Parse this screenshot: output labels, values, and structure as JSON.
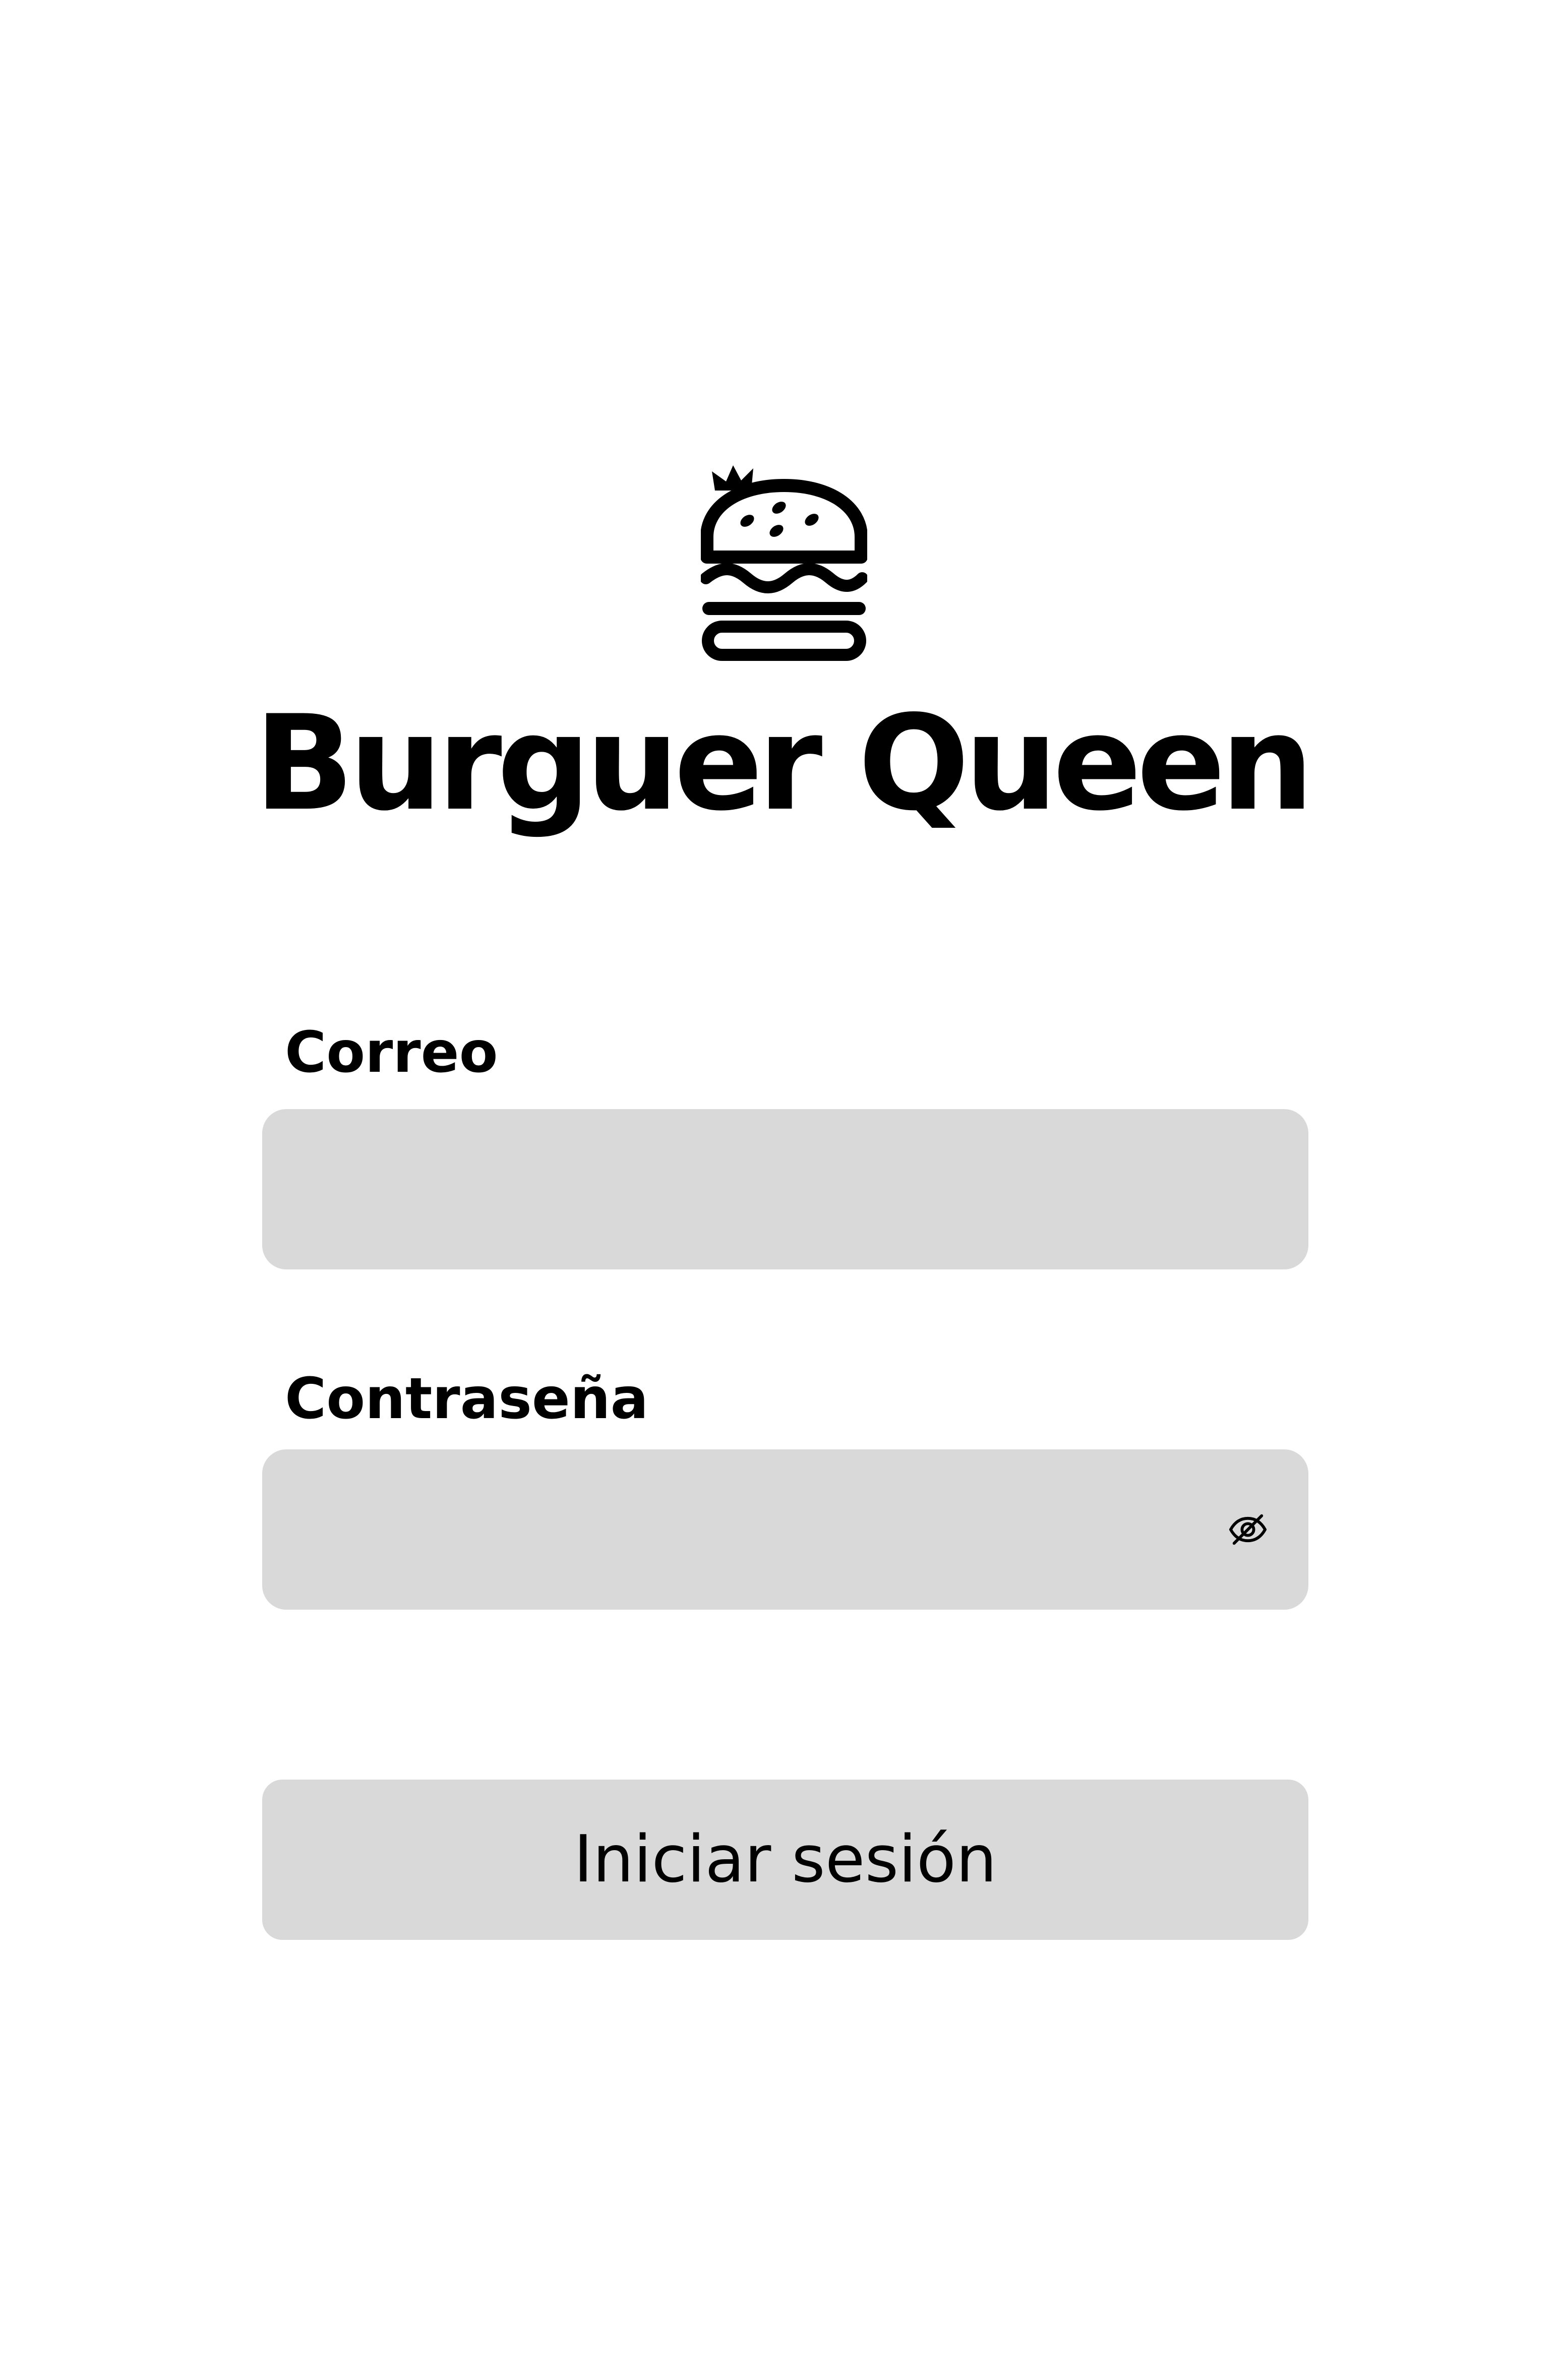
{
  "brand": {
    "name": "Burguer Queen",
    "logo_icon": "crowned-burger-icon"
  },
  "login_form": {
    "email_label": "Correo",
    "email_value": "",
    "password_label": "Contraseña",
    "password_value": "",
    "password_toggle_icon": "eye-slash-icon",
    "submit_label": "Iniciar sesión"
  },
  "colors": {
    "background": "#ffffff",
    "field_background": "#d9d9d9",
    "text": "#000000"
  }
}
